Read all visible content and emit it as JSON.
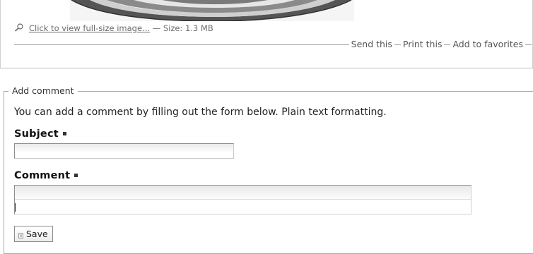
{
  "image_block": {
    "photo_alt_icon": "photo-preview",
    "link_text": "Click to view full-size image...",
    "separator": "—",
    "size_text": "Size: 1.3 MB",
    "actions": [
      {
        "label": "Send this",
        "icon": "none"
      },
      {
        "label": "Print this",
        "icon": "none"
      },
      {
        "label": "Add to favorites",
        "icon": "none"
      }
    ]
  },
  "comment_form": {
    "legend": "Add comment",
    "intro": "You can add a comment by filling out the form below. Plain text formatting.",
    "subject": {
      "label": "Subject",
      "value": "",
      "placeholder": ""
    },
    "comment": {
      "label": "Comment",
      "value": "",
      "placeholder": ""
    },
    "save_label": "Save"
  },
  "colors": {
    "link": "#6b6b6b",
    "border": "#a8a8a8",
    "text": "#222222"
  }
}
